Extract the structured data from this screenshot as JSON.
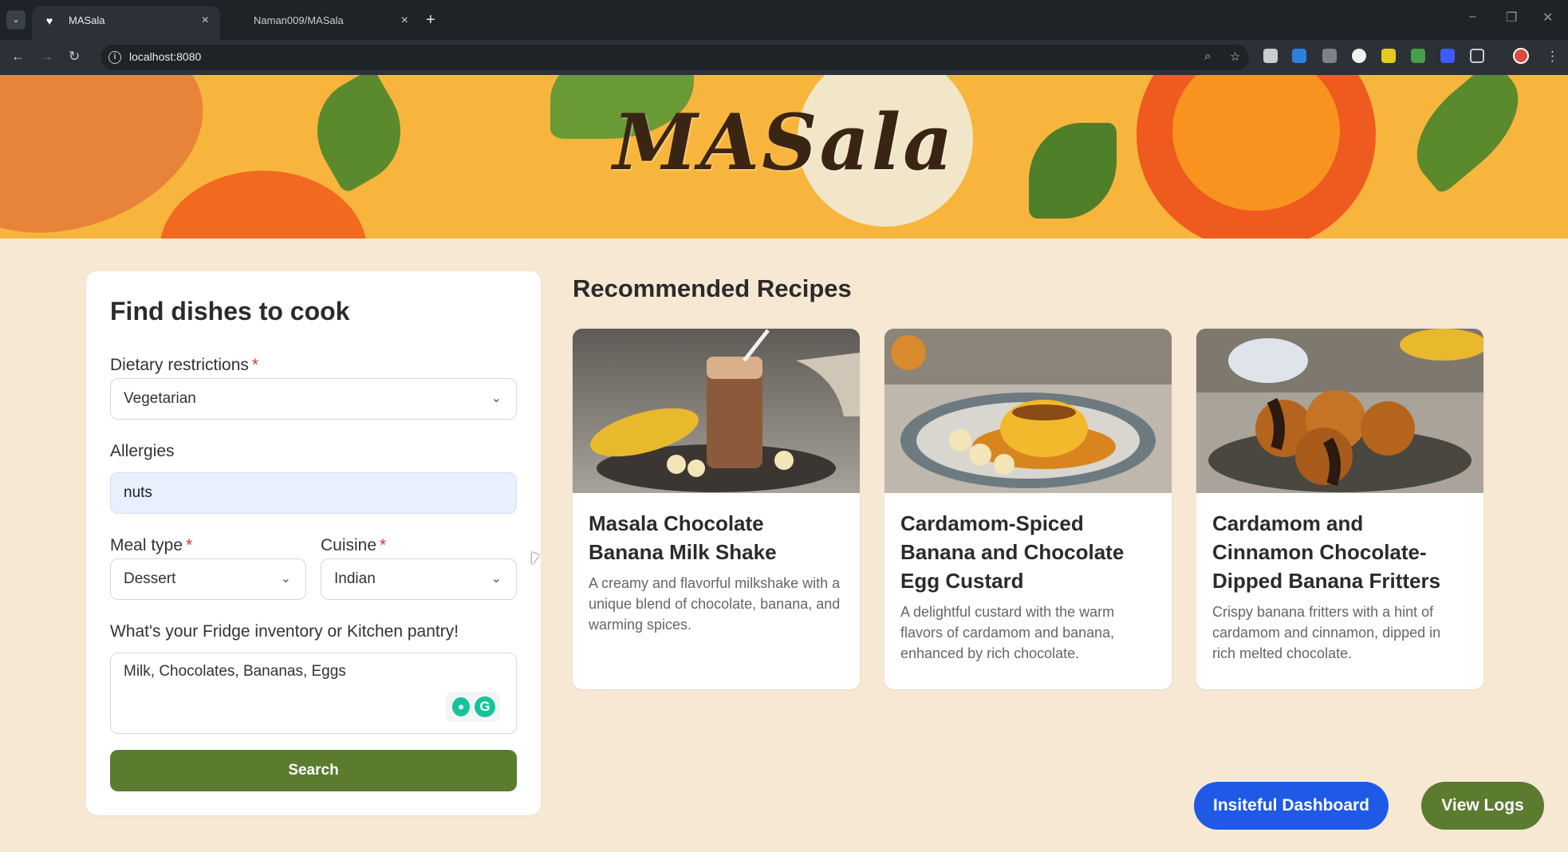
{
  "browser": {
    "tabs": [
      {
        "title": "MASala",
        "active": true,
        "icon": "heart-icon"
      },
      {
        "title": "Naman009/MASala",
        "active": false
      }
    ],
    "url": "localhost:8080"
  },
  "banner": {
    "logo": "MASala"
  },
  "form": {
    "title": "Find dishes to cook",
    "dietary": {
      "label": "Dietary restrictions",
      "required": "*",
      "value": "Vegetarian"
    },
    "allergies": {
      "label": "Allergies",
      "value": "nuts"
    },
    "meal_type": {
      "label": "Meal type",
      "required": "*",
      "value": "Dessert"
    },
    "cuisine": {
      "label": "Cuisine",
      "required": "*",
      "value": "Indian"
    },
    "pantry": {
      "label": "What's your Fridge inventory or Kitchen pantry!",
      "value": "Milk, Chocolates, Bananas, Eggs"
    },
    "search_label": "Search"
  },
  "recipes": {
    "title": "Recommended Recipes",
    "items": [
      {
        "title": "Masala Chocolate Banana Milk Shake",
        "description": "A creamy and flavorful milkshake with a unique blend of chocolate, banana, and warming spices."
      },
      {
        "title": "Cardamom-Spiced Banana and Chocolate Egg Custard",
        "description": "A delightful custard with the warm flavors of cardamom and banana, enhanced by rich chocolate."
      },
      {
        "title": "Cardamom and Cinnamon Chocolate-Dipped Banana Fritters",
        "description": "Crispy banana fritters with a hint of cardamom and cinnamon, dipped in rich melted chocolate."
      }
    ]
  },
  "actions": {
    "dashboard_label": "Insiteful Dashboard",
    "logs_label": "View Logs"
  },
  "colors": {
    "accent_green": "#5b7b2f",
    "dashboard_blue": "#1f5ae6",
    "banner_orange": "#f8b53d",
    "page_bg": "#f7e8d3"
  }
}
